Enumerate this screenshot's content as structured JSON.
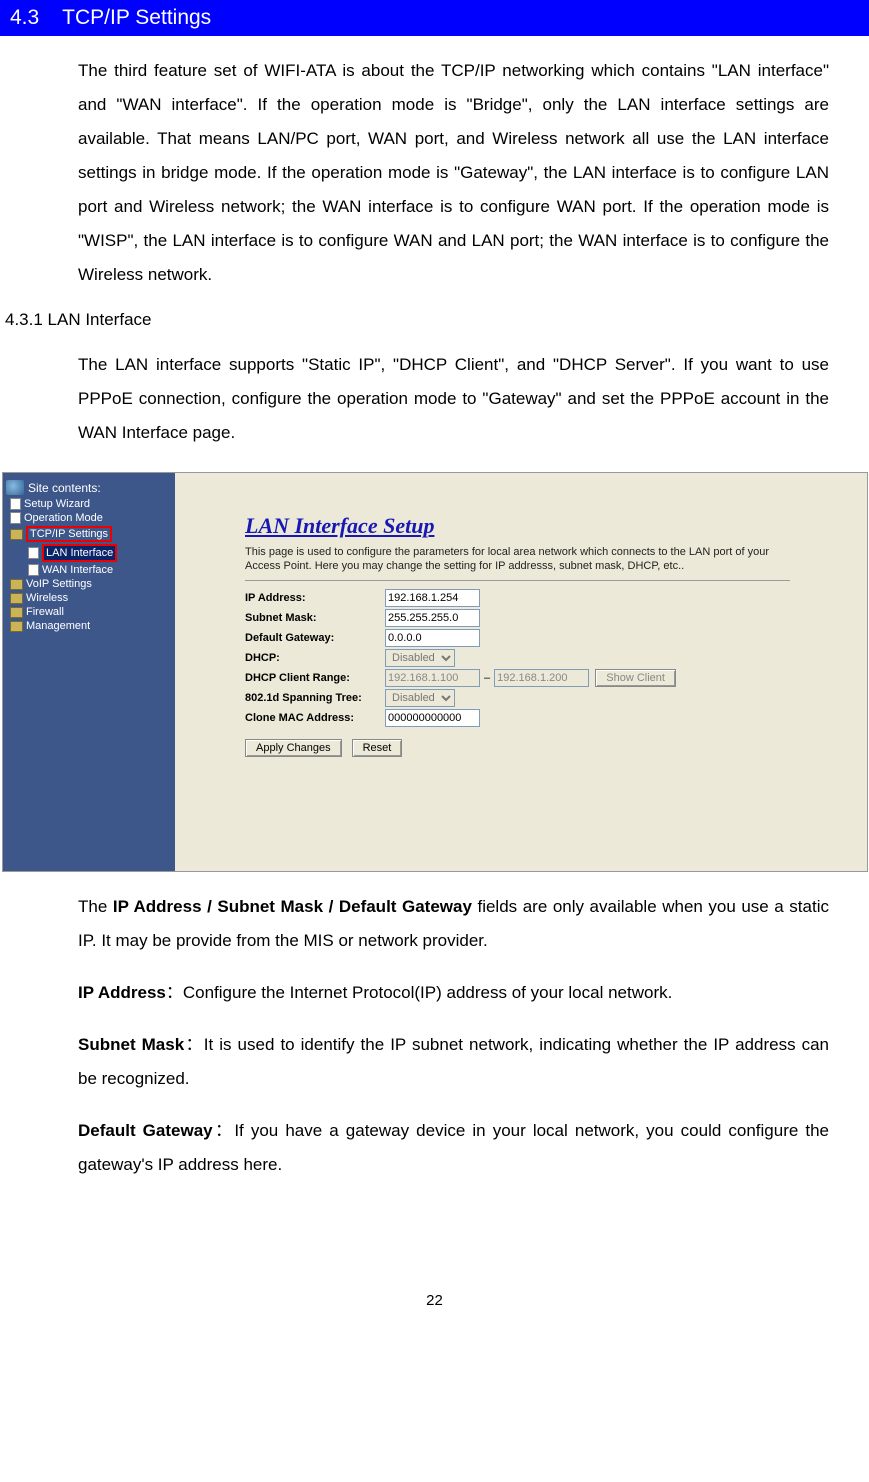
{
  "header": {
    "section_number": "4.3",
    "section_title": "TCP/IP Settings"
  },
  "para1": "The third feature set of WIFI-ATA is about the TCP/IP networking which contains \"LAN interface\" and \"WAN interface\". If the operation mode is \"Bridge\", only the LAN interface settings are available. That means LAN/PC port, WAN port, and Wireless network all use the LAN interface settings in bridge mode. If the operation mode is \"Gateway\", the LAN interface is to configure LAN port and Wireless network; the WAN interface is to configure WAN port. If the operation mode is \"WISP\", the LAN interface is to configure WAN and LAN port; the WAN interface is to configure the Wireless network.",
  "subheading": "4.3.1 LAN Interface",
  "para2": "The LAN interface supports \"Static IP\", \"DHCP Client\", and \"DHCP Server\". If you want to use PPPoE connection, configure the operation mode to \"Gateway\" and set the PPPoE account in the WAN Interface page.",
  "sidebar": {
    "title": "Site contents:",
    "items": [
      "Setup Wizard",
      "Operation Mode",
      "TCP/IP Settings",
      "LAN Interface",
      "WAN Interface",
      "VoIP Settings",
      "Wireless",
      "Firewall",
      "Management"
    ]
  },
  "panel": {
    "title": "LAN Interface Setup",
    "desc": "This page is used to configure the parameters for local area network which connects to the LAN port of your Access Point. Here you may change the setting for IP addresss, subnet mask, DHCP, etc..",
    "labels": {
      "ip": "IP Address:",
      "mask": "Subnet Mask:",
      "gw": "Default Gateway:",
      "dhcp": "DHCP:",
      "range": "DHCP Client Range:",
      "stp": "802.1d Spanning Tree:",
      "mac": "Clone MAC Address:"
    },
    "values": {
      "ip": "192.168.1.254",
      "mask": "255.255.255.0",
      "gw": "0.0.0.0",
      "dhcp": "Disabled",
      "range_start": "192.168.1.100",
      "range_end": "192.168.1.200",
      "stp": "Disabled",
      "mac": "000000000000"
    },
    "buttons": {
      "show_client": "Show Client",
      "apply": "Apply Changes",
      "reset": "Reset"
    }
  },
  "para3_lead": "The ",
  "para3_bold": "IP Address / Subnet Mask / Default Gateway",
  "para3_tail": " fields are only available when you use a static IP. It may be provide from the MIS or network provider.",
  "defs": {
    "ip_label": "IP Address",
    "ip_sep": "：",
    "ip_text": "Configure the Internet Protocol(IP) address of your local network.",
    "mask_label": "Subnet Mask",
    "mask_sep": "：",
    "mask_text": "It is used to identify the IP subnet network, indicating whether the IP address can be recognized.",
    "gw_label": "Default Gateway",
    "gw_sep": "：",
    "gw_text": "If you have a gateway device in your local network, you could configure the gateway's IP address here."
  },
  "page_number": "22"
}
